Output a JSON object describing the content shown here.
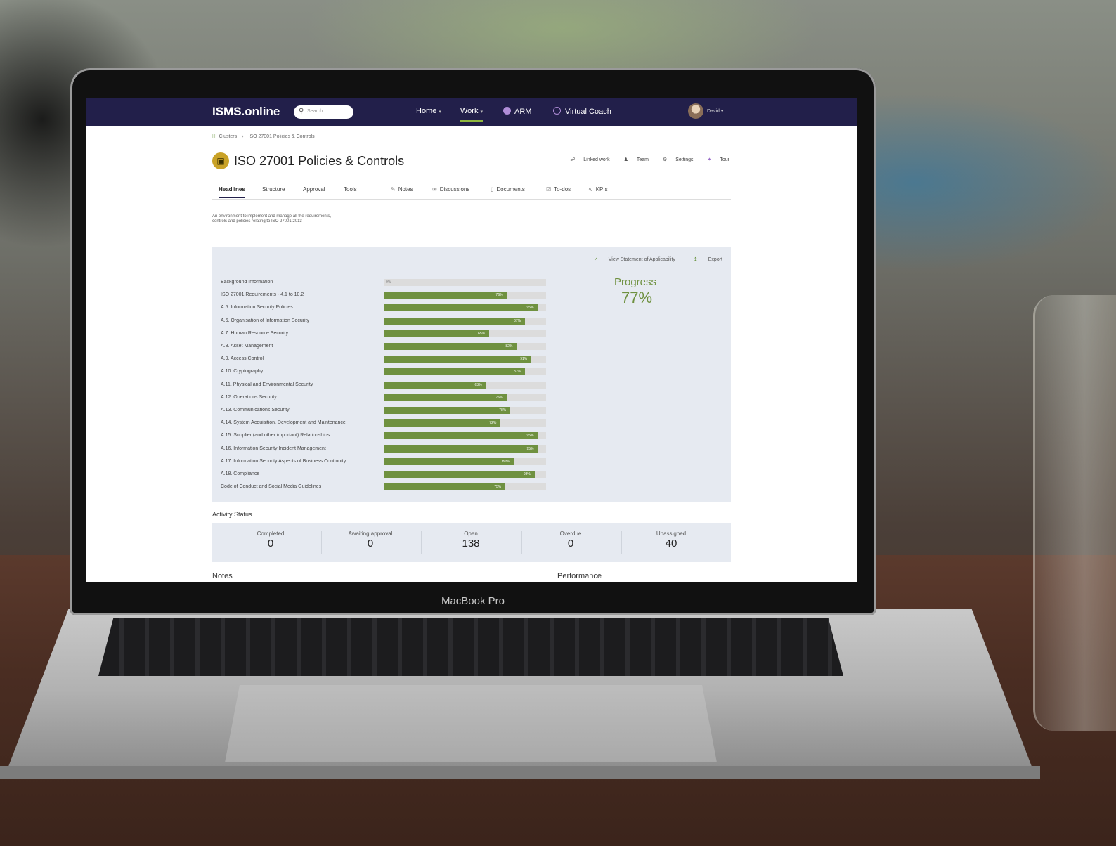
{
  "device": {
    "label": "MacBook Pro"
  },
  "app": {
    "logo": "ISMS.online",
    "search_placeholder": "Search",
    "nav": [
      {
        "label": "Home",
        "caret": "▾"
      },
      {
        "label": "Work",
        "caret": "▾"
      },
      {
        "label": "ARM"
      },
      {
        "label": "Virtual Coach"
      }
    ],
    "user": {
      "name": "David",
      "caret": "▾"
    }
  },
  "breadcrumb": {
    "root": "Clusters",
    "separator": "›",
    "current": "ISO 27001 Policies & Controls"
  },
  "page": {
    "badge_icon": "map-icon",
    "title": "ISO 27001 Policies & Controls",
    "actions": [
      "Linked work",
      "Team",
      "Settings",
      "Tour"
    ],
    "tabs": [
      "Headlines",
      "Structure",
      "Approval",
      "Tools",
      "Notes",
      "Discussions",
      "Documents",
      "To-dos",
      "KPIs"
    ],
    "description": "An environment to implement and manage all the requirements, controls and policies relating to ISO 27001:2013"
  },
  "panel": {
    "links": [
      "View Statement of Applicability",
      "Export"
    ],
    "progress_label": "Progress",
    "progress_value": "77%",
    "rows": [
      {
        "label": "Background Information",
        "pct": 0,
        "text": "0%"
      },
      {
        "label": "ISO 27001 Requirements - 4.1 to 10.2",
        "pct": 76,
        "text": "76%"
      },
      {
        "label": "A.5. Information Security Policies",
        "pct": 95,
        "text": "95%"
      },
      {
        "label": "A.6. Organisation of Information Security",
        "pct": 87,
        "text": "87%"
      },
      {
        "label": "A.7. Human Resource Security",
        "pct": 65,
        "text": "65%"
      },
      {
        "label": "A.8. Asset Management",
        "pct": 82,
        "text": "82%"
      },
      {
        "label": "A.9. Access Control",
        "pct": 91,
        "text": "91%"
      },
      {
        "label": "A.10. Cryptography",
        "pct": 87,
        "text": "87%"
      },
      {
        "label": "A.11. Physical and Environmental Security",
        "pct": 63,
        "text": "63%"
      },
      {
        "label": "A.12. Operations Security",
        "pct": 76,
        "text": "76%"
      },
      {
        "label": "A.13. Communications Security",
        "pct": 78,
        "text": "78%"
      },
      {
        "label": "A.14. System Acquisition, Development and Maintenance",
        "pct": 72,
        "text": "72%"
      },
      {
        "label": "A.15. Supplier (and other important) Relationships",
        "pct": 95,
        "text": "95%"
      },
      {
        "label": "A.16. Information Security Incident Management",
        "pct": 95,
        "text": "95%"
      },
      {
        "label": "A.17. Information Security Aspects of Business Continuity ...",
        "pct": 80,
        "text": "80%"
      },
      {
        "label": "A.18. Compliance",
        "pct": 93,
        "text": "93%"
      },
      {
        "label": "Code of Conduct and Social Media Guidelines",
        "pct": 75,
        "text": "75%"
      }
    ]
  },
  "activity": {
    "title": "Activity Status",
    "stats": [
      {
        "label": "Completed",
        "value": "0"
      },
      {
        "label": "Awaiting approval",
        "value": "0"
      },
      {
        "label": "Open",
        "value": "138"
      },
      {
        "label": "Overdue",
        "value": "0"
      },
      {
        "label": "Unassigned",
        "value": "40"
      }
    ]
  },
  "sections": {
    "notes": "Notes",
    "performance": "Performance"
  },
  "colors": {
    "nav_bg": "#221f4a",
    "accent_green": "#6f9140",
    "panel_bg": "#e6eaf1"
  }
}
